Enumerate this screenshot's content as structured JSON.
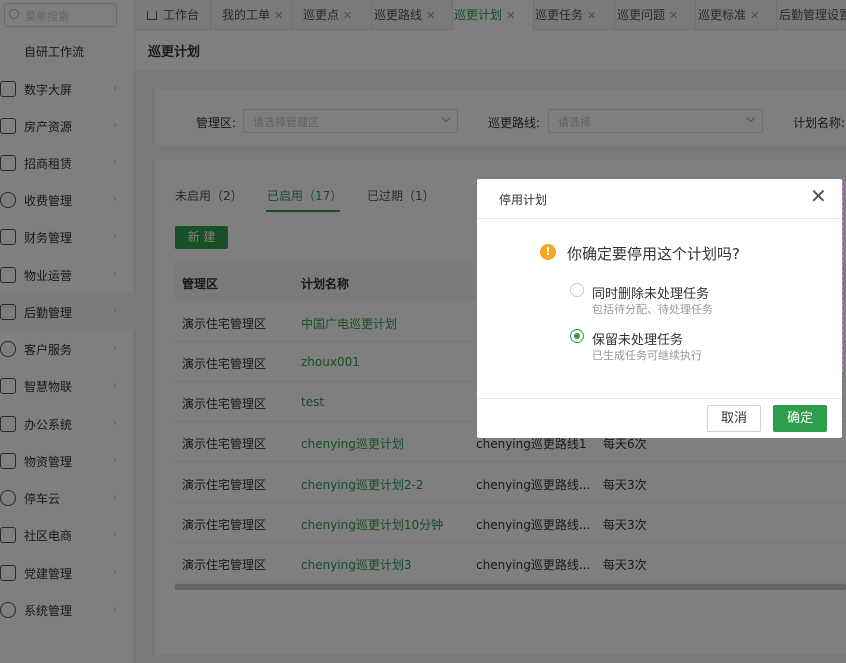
{
  "sidebar": {
    "search_placeholder": "菜单搜索",
    "top_label": "自研工作流",
    "items": [
      {
        "label": "数字大屏",
        "icon": "monitor-icon"
      },
      {
        "label": "房产资源",
        "icon": "building-icon"
      },
      {
        "label": "招商租赁",
        "icon": "house-icon"
      },
      {
        "label": "收费管理",
        "icon": "money-bag-icon"
      },
      {
        "label": "财务管理",
        "icon": "finance-icon"
      },
      {
        "label": "物业运营",
        "icon": "property-icon"
      },
      {
        "label": "后勤管理",
        "icon": "logistics-icon"
      },
      {
        "label": "客户服务",
        "icon": "customer-service-icon"
      },
      {
        "label": "智慧物联",
        "icon": "iot-icon"
      },
      {
        "label": "办公系统",
        "icon": "office-icon"
      },
      {
        "label": "物资管理",
        "icon": "warehouse-icon"
      },
      {
        "label": "停车云",
        "icon": "parking-icon"
      },
      {
        "label": "社区电商",
        "icon": "shop-icon"
      },
      {
        "label": "党建管理",
        "icon": "party-icon"
      },
      {
        "label": "系统管理",
        "icon": "settings-icon"
      }
    ]
  },
  "tabs": [
    "工作台",
    "我的工单",
    "巡更点",
    "巡更路线",
    "巡更计划",
    "巡更任务",
    "巡更问题",
    "巡更标准",
    "后勤管理设置"
  ],
  "page": {
    "title": "巡更计划"
  },
  "filters": {
    "area_label": "管理区:",
    "area_placeholder": "请选择管理区",
    "route_label": "巡更路线:",
    "route_placeholder": "请选择",
    "plan_label": "计划名称:"
  },
  "status_tabs": [
    "未启用（2）",
    "已启用（17）",
    "已过期（1）"
  ],
  "new_button": "新 建",
  "table": {
    "headers": [
      "管理区",
      "计划名称"
    ],
    "rows": [
      {
        "area": "演示住宅管理区",
        "plan": "中国广电巡更计划",
        "route": "",
        "freq": ""
      },
      {
        "area": "演示住宅管理区",
        "plan": "zhoux001",
        "route": "",
        "freq": ""
      },
      {
        "area": "演示住宅管理区",
        "plan": "test",
        "route": "",
        "freq": ""
      },
      {
        "area": "演示住宅管理区",
        "plan": "chenying巡更计划",
        "route": "chenying巡更路线1",
        "freq": "每天6次"
      },
      {
        "area": "演示住宅管理区",
        "plan": "chenying巡更计划2-2",
        "route": "chenying巡更路线...",
        "freq": "每天3次"
      },
      {
        "area": "演示住宅管理区",
        "plan": "chenying巡更计划10分钟",
        "route": "chenying巡更路线...",
        "freq": "每天3次"
      },
      {
        "area": "演示住宅管理区",
        "plan": "chenying巡更计划3",
        "route": "chenying巡更路线...",
        "freq": "每天3次"
      }
    ]
  },
  "modal": {
    "title": "停用计划",
    "question": "你确定要停用这个计划吗?",
    "option1_label": "同时删除未处理任务",
    "option1_sub": "包括待分配、待处理任务",
    "option2_label": "保留未处理任务",
    "option2_sub": "已生成任务可继续执行",
    "selected_option": 2,
    "cancel": "取消",
    "ok": "确定"
  },
  "colors": {
    "accent": "#2e9e4c",
    "warning": "#f5a623"
  }
}
